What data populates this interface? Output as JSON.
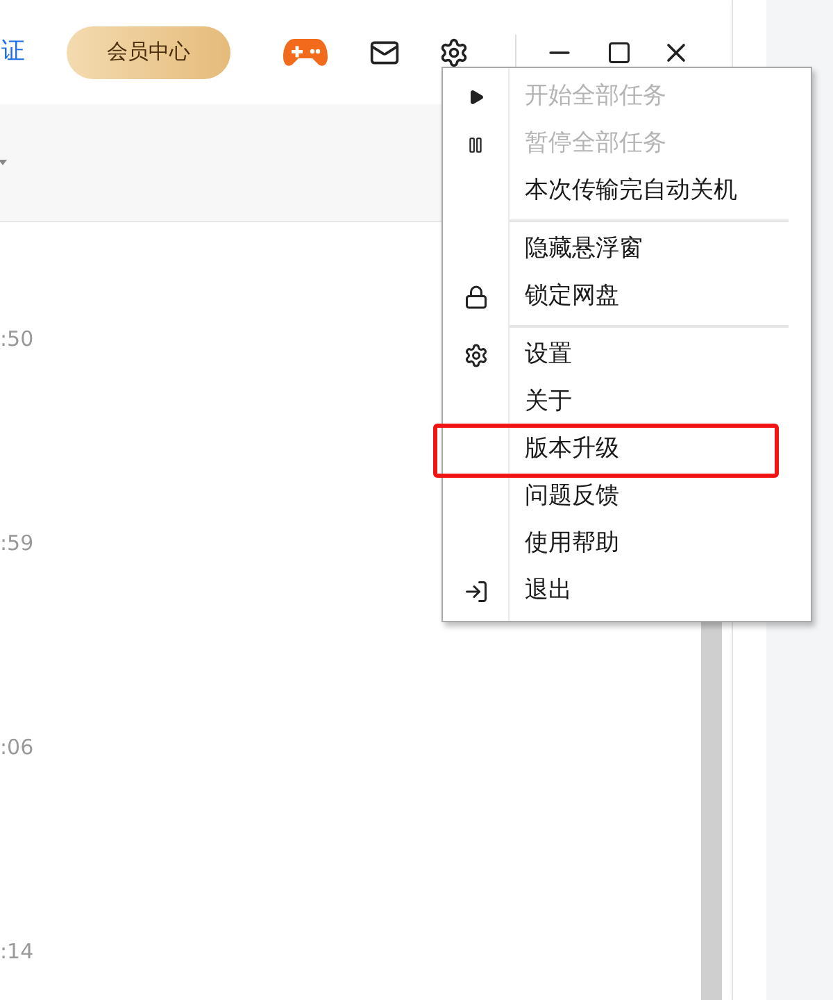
{
  "header": {
    "verify_link": "证",
    "vip_button": "会员中心"
  },
  "times": [
    ":50",
    ":59",
    ":06",
    ":14"
  ],
  "menu": {
    "groups": [
      [
        {
          "kind": "start",
          "label": "开始全部任务",
          "disabled": true,
          "annotated": false
        },
        {
          "kind": "pause",
          "label": "暂停全部任务",
          "disabled": true,
          "annotated": false
        },
        {
          "kind": "plain",
          "label": "本次传输完自动关机",
          "disabled": false,
          "annotated": false
        }
      ],
      [
        {
          "kind": "plain",
          "label": "隐藏悬浮窗",
          "disabled": false,
          "annotated": false
        },
        {
          "kind": "lock",
          "label": "锁定网盘",
          "disabled": false,
          "annotated": false
        }
      ],
      [
        {
          "kind": "settings",
          "label": "设置",
          "disabled": false,
          "annotated": false
        },
        {
          "kind": "plain",
          "label": "关于",
          "disabled": false,
          "annotated": false
        },
        {
          "kind": "plain",
          "label": "版本升级",
          "disabled": false,
          "annotated": true
        },
        {
          "kind": "plain",
          "label": "问题反馈",
          "disabled": false,
          "annotated": false
        },
        {
          "kind": "plain",
          "label": "使用帮助",
          "disabled": false,
          "annotated": false
        },
        {
          "kind": "exit",
          "label": "退出",
          "disabled": false,
          "annotated": false
        }
      ]
    ]
  }
}
